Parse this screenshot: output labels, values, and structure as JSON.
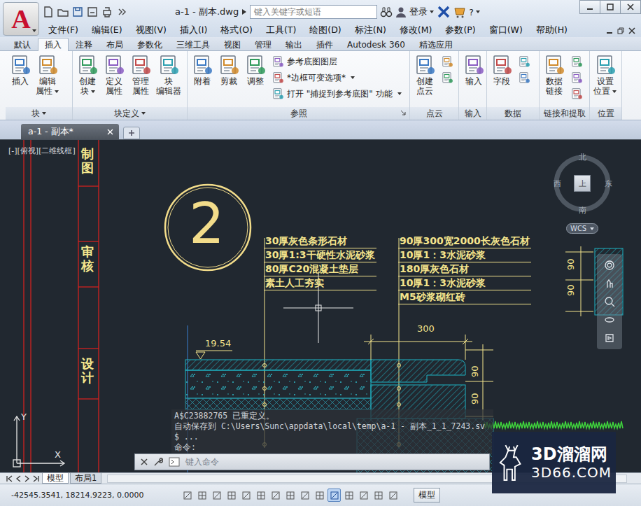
{
  "app": {
    "logo": "A"
  },
  "window": {
    "title": "a-1 - 副本.dwg",
    "search_placeholder": "键入关键字或短语",
    "login": "登录",
    "help": "?"
  },
  "menu": [
    "文件(F)",
    "编辑(E)",
    "视图(V)",
    "插入(I)",
    "格式(O)",
    "工具(T)",
    "绘图(D)",
    "标注(N)",
    "修改(M)",
    "参数(P)",
    "窗口(W)",
    "帮助(H)"
  ],
  "ribbon_tabs": [
    {
      "label": "默认",
      "selected": false
    },
    {
      "label": "插入",
      "selected": true
    },
    {
      "label": "注释",
      "selected": false
    },
    {
      "label": "布局",
      "selected": false
    },
    {
      "label": "参数化",
      "selected": false
    },
    {
      "label": "三维工具",
      "selected": false
    },
    {
      "label": "视图",
      "selected": false
    },
    {
      "label": "管理",
      "selected": false
    },
    {
      "label": "输出",
      "selected": false
    },
    {
      "label": "插件",
      "selected": false
    },
    {
      "label": "Autodesk 360",
      "selected": false
    },
    {
      "label": "精选应用",
      "selected": false
    }
  ],
  "ribbon_groups": [
    {
      "title": "块",
      "menu": true,
      "launcher": false,
      "tools": [
        {
          "kind": "large",
          "lines": [
            "插入"
          ],
          "dropdown": false
        },
        {
          "kind": "large",
          "lines": [
            "编辑",
            "属性"
          ],
          "dropdown": true
        }
      ]
    },
    {
      "title": "块定义",
      "menu": true,
      "launcher": false,
      "tools": [
        {
          "kind": "large",
          "lines": [
            "创建",
            "块"
          ],
          "dropdown": true
        },
        {
          "kind": "large",
          "lines": [
            "定义",
            "属性"
          ],
          "dropdown": false
        },
        {
          "kind": "large",
          "lines": [
            "管理",
            "属性"
          ],
          "dropdown": false
        },
        {
          "kind": "large",
          "lines": [
            "块",
            "编辑器"
          ],
          "dropdown": false
        }
      ]
    },
    {
      "title": "参照",
      "menu": false,
      "launcher": true,
      "tools": [
        {
          "kind": "large",
          "lines": [
            "附着"
          ],
          "dropdown": false
        },
        {
          "kind": "large",
          "lines": [
            "剪裁"
          ],
          "dropdown": false
        },
        {
          "kind": "large",
          "lines": [
            "调整"
          ],
          "dropdown": false
        },
        {
          "kind": "small",
          "lines": [
            "参考底图图层"
          ],
          "dropdown": false
        },
        {
          "kind": "small",
          "lines": [
            "*边框可变选项*"
          ],
          "dropdown": true
        },
        {
          "kind": "small",
          "lines": [
            "打开 \"捕捉到参考底图\" 功能"
          ],
          "dropdown": true
        }
      ]
    },
    {
      "title": "点云",
      "menu": false,
      "launcher": false,
      "tools": [
        {
          "kind": "large",
          "lines": [
            "创建",
            "点云"
          ],
          "dropdown": false
        },
        {
          "kind": "icon",
          "lines": [],
          "dropdown": false
        },
        {
          "kind": "icon",
          "lines": [],
          "dropdown": false
        }
      ]
    },
    {
      "title": "输入",
      "menu": false,
      "launcher": false,
      "tools": [
        {
          "kind": "large",
          "lines": [
            "输入"
          ],
          "dropdown": false
        }
      ]
    },
    {
      "title": "数据",
      "menu": false,
      "launcher": false,
      "tools": [
        {
          "kind": "large",
          "lines": [
            "字段"
          ],
          "dropdown": false
        },
        {
          "kind": "icon",
          "lines": [],
          "dropdown": false
        },
        {
          "kind": "icon",
          "lines": [],
          "dropdown": false
        }
      ]
    },
    {
      "title": "链接和提取",
      "menu": false,
      "launcher": false,
      "tools": [
        {
          "kind": "large",
          "lines": [
            "数据",
            "链接"
          ],
          "dropdown": false
        },
        {
          "kind": "icon",
          "lines": [],
          "dropdown": false
        },
        {
          "kind": "icon",
          "lines": [],
          "dropdown": false
        },
        {
          "kind": "icon",
          "lines": [],
          "dropdown": false
        }
      ]
    },
    {
      "title": "位置",
      "menu": false,
      "launcher": false,
      "tools": [
        {
          "kind": "large",
          "lines": [
            "设置",
            "位置"
          ],
          "dropdown": true
        }
      ]
    }
  ],
  "document_tabs": [
    {
      "label": "a-1 - 副本*",
      "selected": true
    }
  ],
  "drawing": {
    "viewport_label": "[-][俯视][二维线框]",
    "title_block": [
      "制图",
      "审核",
      "设计"
    ],
    "detail_number": "2",
    "notes": [
      {
        "lines": [
          "30厚灰色条形石材",
          "30厚1:3干硬性水泥砂浆",
          "80厚C20混凝土垫层",
          "素土人工夯实"
        ]
      },
      {
        "lines": [
          "90厚300宽2000长灰色石材",
          "10厚1：3水泥砂浆",
          "180厚灰色石材",
          "10厚1：3水泥砂浆",
          "M5砂浆砌红砖"
        ]
      }
    ],
    "elevation": "19.54",
    "dimensions": [
      "300",
      "90",
      "90",
      "90",
      "90"
    ]
  },
  "viewcube": {
    "north": "北",
    "south": "南",
    "east": "东",
    "west": "西",
    "top": "上",
    "ucs_menu": "WCS"
  },
  "command_line": {
    "history": [
      "A$C23882765 已重定义。",
      "自动保存到 C:\\Users\\Sunc\\appdata\\local\\temp\\a-1 - 副本_1_1_7243.sv",
      "$ ...",
      "命令:"
    ],
    "placeholder": "键入命令"
  },
  "ucs_icon": {
    "x": "X",
    "y": "Y"
  },
  "layout_tabs": [
    {
      "label": "模型",
      "selected": true
    },
    {
      "label": "布局1",
      "selected": false
    }
  ],
  "status_bar": {
    "coordinates": "-42545.3541, 18214.9223, 0.0000",
    "space": "模型",
    "toggles": [
      {
        "on": false
      },
      {
        "on": false
      },
      {
        "on": false
      },
      {
        "on": false
      },
      {
        "on": false
      },
      {
        "on": false
      },
      {
        "on": false
      },
      {
        "on": false
      },
      {
        "on": false
      },
      {
        "on": false
      },
      {
        "on": true
      },
      {
        "on": false
      },
      {
        "on": false
      },
      {
        "on": false
      },
      {
        "on": false
      }
    ]
  },
  "watermark": {
    "name": "3D溜溜网",
    "url": "3D66.COM"
  }
}
